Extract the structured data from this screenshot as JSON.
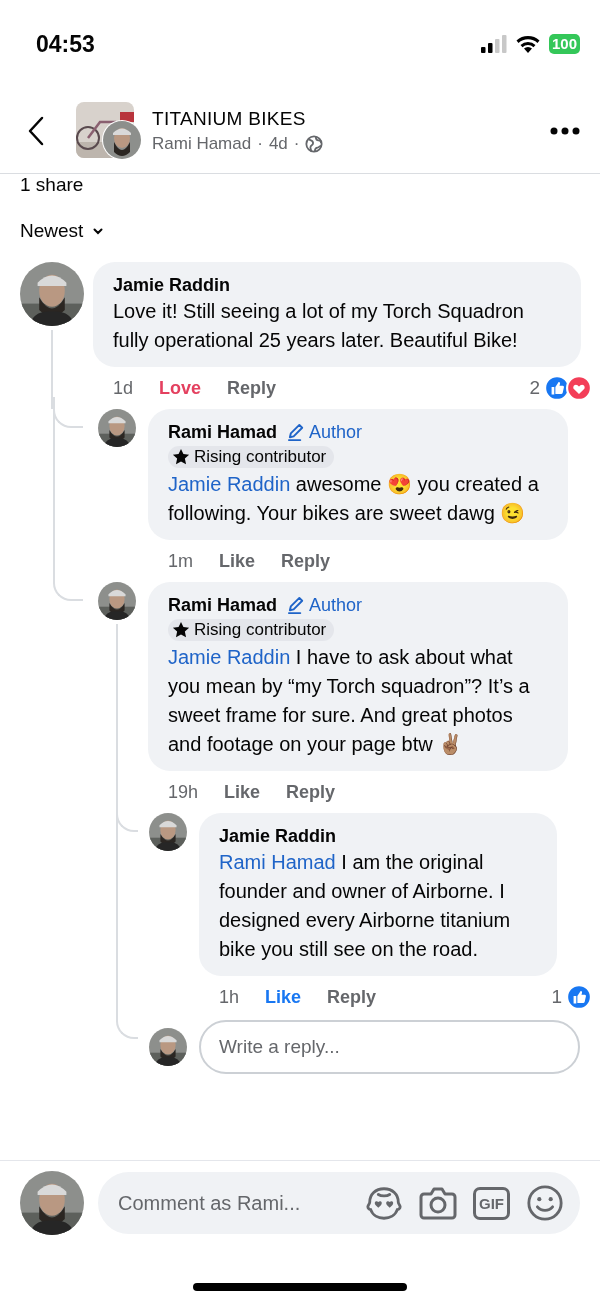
{
  "status_bar": {
    "time": "04:53",
    "battery": "100"
  },
  "header": {
    "title": "TITANIUM BIKES",
    "author": "Rami Hamad",
    "separator": "·",
    "age": "4d",
    "separator_2": "·"
  },
  "shares": "1 share",
  "sort": {
    "label": "Newest"
  },
  "comments": [
    {
      "author": "Jamie Raddin",
      "text": "Love it! Still seeing a lot of my Torch Squadron fully operational 25 years later. Beautiful Bike!",
      "time": "1d",
      "reaction": {
        "kind": "love",
        "label": "Love",
        "selected": true
      },
      "reply_label": "Reply",
      "reactions": {
        "count": "2",
        "icons": [
          {
            "kind": "like"
          },
          {
            "kind": "love"
          }
        ]
      },
      "children": [
        {
          "author": "Rami Hamad",
          "badges": [
            {
              "kind": "author",
              "label": "Author"
            },
            {
              "kind": "contributor",
              "label": "Rising contributor"
            }
          ],
          "mention": "Jamie Raddin",
          "text": "awesome 😍 you created a following. Your bikes are sweet dawg 😉",
          "time": "1m",
          "reaction": {
            "label": "Like",
            "selected": false
          },
          "reply_label": "Reply"
        },
        {
          "author": "Rami Hamad",
          "badges": [
            {
              "kind": "author",
              "label": "Author"
            },
            {
              "kind": "contributor",
              "label": "Rising contributor"
            }
          ],
          "mention": "Jamie Raddin",
          "text": "I have to ask about what you mean by “my Torch squadron”? It’s a sweet frame for sure. And great photos and footage on your page btw ✌🏽",
          "time": "19h",
          "reaction": {
            "label": "Like",
            "selected": false
          },
          "reply_label": "Reply",
          "children": [
            {
              "author": "Jamie Raddin",
              "mention": "Rami Hamad",
              "text": "I am the original founder and owner of Airborne.  I designed every Airborne titanium bike you still see on the road.",
              "time": "1h",
              "reaction": {
                "label": "Like",
                "selected": true
              },
              "reply_label": "Reply",
              "reactions": {
                "count": "1",
                "icons": [
                  {
                    "kind": "like"
                  }
                ]
              }
            }
          ],
          "reply_field": {
            "placeholder": "Write a reply..."
          }
        }
      ]
    }
  ],
  "composer": {
    "placeholder": "Comment as Rami...",
    "gif_label": "GIF"
  }
}
